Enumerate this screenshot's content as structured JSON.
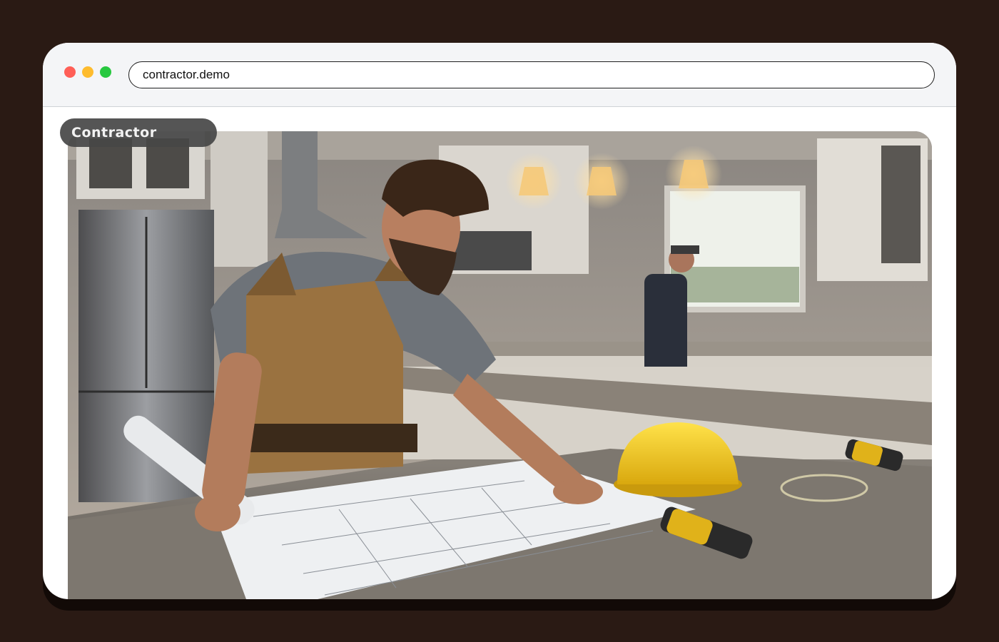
{
  "browser": {
    "url": "contractor.demo"
  },
  "hero": {
    "label": "Contractor"
  },
  "icons": [
    "close-dot",
    "minimize-dot",
    "maximize-dot"
  ],
  "colors": {
    "page_background": "#2a1a14",
    "window_background": "#ffffff",
    "chrome_background": "#f4f5f7",
    "label_background": "#464646",
    "hardhat": "#f2c81c"
  }
}
